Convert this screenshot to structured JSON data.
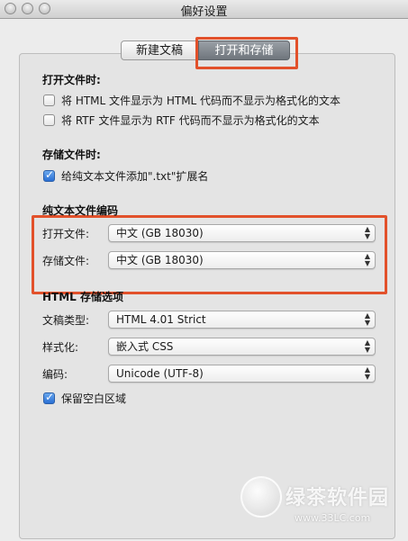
{
  "window": {
    "title": "偏好设置"
  },
  "tabs": [
    {
      "label": "新建文稿"
    },
    {
      "label": "打开和存储"
    }
  ],
  "open_section": {
    "heading": "打开文件时:",
    "options": [
      {
        "label": "将 HTML 文件显示为 HTML 代码而不显示为格式化的文本",
        "checked": false
      },
      {
        "label": "将 RTF 文件显示为 RTF 代码而不显示为格式化的文本",
        "checked": false
      }
    ]
  },
  "save_section": {
    "heading": "存储文件时:",
    "options": [
      {
        "label": "给纯文本文件添加\".txt\"扩展名",
        "checked": true
      }
    ]
  },
  "encoding_section": {
    "heading": "纯文本文件编码",
    "open_label": "打开文件:",
    "open_value": "中文 (GB 18030)",
    "save_label": "存储文件:",
    "save_value": "中文 (GB 18030)"
  },
  "html_section": {
    "heading": "HTML 存储选项",
    "doc_type_label": "文稿类型:",
    "doc_type_value": "HTML 4.01 Strict",
    "styling_label": "样式化:",
    "styling_value": "嵌入式 CSS",
    "encoding_label": "编码:",
    "encoding_value": "Unicode (UTF-8)",
    "preserve_label": "保留空白区域",
    "preserve_checked": true
  },
  "watermark": {
    "text": "绿茶软件园",
    "url": "www.33LC.com"
  },
  "colors": {
    "highlight": "#e2512b",
    "checkbox_checked": "#2a6fd4"
  }
}
